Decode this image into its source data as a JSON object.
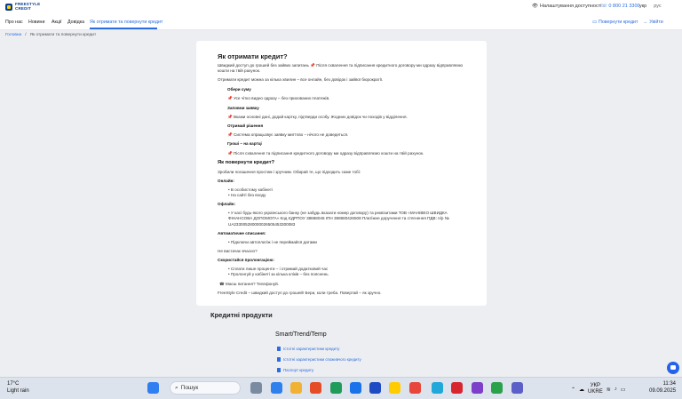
{
  "header": {
    "logo_line1": "FREESTYLE",
    "logo_line2": "CREDIT",
    "accessibility": "Налаштування доступності",
    "phone": "0 800 21 3300",
    "lang_ua": "укр",
    "lang_ru": "рус"
  },
  "nav": {
    "items": [
      "Про нас",
      "Новини",
      "Акції",
      "Довідка",
      "Як отримати та повернути кредит"
    ],
    "repay": "Повернути кредит",
    "login": "Увійти"
  },
  "breadcrumb": {
    "home": "Головна",
    "sep": "/",
    "current": "Як отримати та повернути кредит"
  },
  "article": {
    "title": "Як отримати кредит?",
    "intro": "Швидкий доступ до грошей без зайвих запитань 📌 Після схвалення та підписання кредитного договору ми одразу відправляємо кошти на твій рахунок.",
    "online": "Отримати кредит можна за кілька хвилин – все онлайн, без довідок і зайвої бюрократії.",
    "steps": [
      {
        "title": "Обери суму",
        "text": "📌 Усе чітко видно одразу – без прихованих платежів."
      },
      {
        "title": "Заповни заявку",
        "text": "📌 Вкажи основні дані, додай картку, підтверди особу. Жодних довідок чи походів у відділення."
      },
      {
        "title": "Отримай рішення",
        "text": "📌 Система опрацьовує заявку миттєво – нічого не доведеться."
      },
      {
        "title": "Гроші – на картці",
        "text": "📌 Після схвалення та підписання кредитного договору ми одразу відправляємо кошти на твій рахунок."
      }
    ],
    "repay_title": "Як повернути кредит?",
    "repay_intro": "Зробили погашення простим і зручним. Обирай те, що підходить саме тобі:",
    "online_title": "Онлайн:",
    "online_items": [
      "В особистому кабінеті",
      "На сайті без входу"
    ],
    "offline_title": "Офлайн:",
    "offline_text": "У касі будь-якого українського банку (не забудь вказати номер договору) та реквізитами ТОВ «МАНІВЕО ШВИДКА ФІНАНСОВА ДОПОМОГА» Код ЄДРПОУ 38868046 ІПН 388680426508 Платіжне доручення та стягнення ПДВ: п/р № UA233005280000026505453300083",
    "auto_title": "Автоматичне списання:",
    "auto_items": [
      "Підключи автоплатіж і не переймайся датами"
    ],
    "plan": "Не вистачає вчасно?",
    "prolong_title": "Скористайся пролонгацією:",
    "prolong_items": [
      "Сплати лише проценти – і отримай додатковий час",
      "Пролонгуй у кабінеті за кілька кліків – без пояснень"
    ],
    "questions": "Маєш питання? Телефонуй.",
    "outro": "FreeStyle Credit – швидкий доступ до грошей! Бери, коли треба. Повертай – як зручно."
  },
  "products": {
    "title": "Кредитні продукти",
    "subtitle": "Smart/Trend/Temp",
    "docs": [
      "Істотні характеристики кредиту",
      "Істотні характеристики споживчого кредиту",
      "Паспорт кредиту"
    ]
  },
  "taskbar": {
    "temp": "17°C",
    "weather": "Light rain",
    "search": "Пошук",
    "lang1": "УКР",
    "lang2": "UKRE",
    "time": "11:34",
    "date": "09.09.2025"
  }
}
